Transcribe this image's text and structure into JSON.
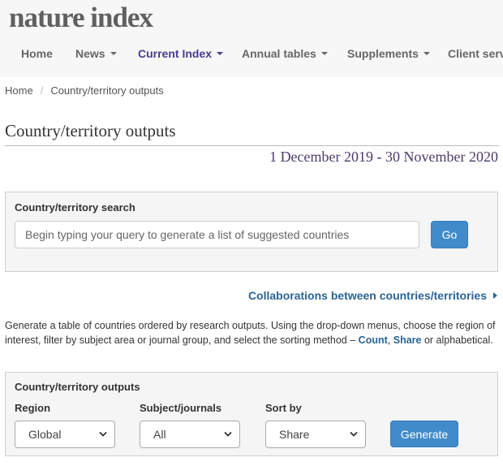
{
  "header": {
    "logo": "nature index",
    "nav": [
      {
        "label": "Home"
      },
      {
        "label": "News"
      },
      {
        "label": "Current Index"
      },
      {
        "label": "Annual tables"
      },
      {
        "label": "Supplements"
      },
      {
        "label": "Client serv"
      }
    ]
  },
  "breadcrumb": {
    "home": "Home",
    "separator": "/",
    "current": "Country/territory outputs"
  },
  "page": {
    "title": "Country/territory outputs",
    "date_start": "1 December 2019",
    "date_dash": "-",
    "date_end": "30 November 2020"
  },
  "search_panel": {
    "label": "Country/territory search",
    "placeholder": "Begin typing your query to generate a list of suggested countries",
    "button": "Go"
  },
  "collab_link": "Collaborations between countries/territories",
  "description": {
    "text_before": "Generate a table of countries ordered by research outputs. Using the drop-down menus, choose the region of interest, filter by subject area or journal group, and select the sorting method – ",
    "link_count": "Count",
    "comma": ", ",
    "link_share": "Share",
    "text_after": " or alphabetical."
  },
  "outputs_panel": {
    "title": "Country/territory outputs",
    "region_label": "Region",
    "region_value": "Global",
    "subject_label": "Subject/journals",
    "subject_value": "All",
    "sort_label": "Sort by",
    "sort_value": "Share",
    "button": "Generate"
  },
  "colors": {
    "header_bg": "#f7f7f7",
    "active_nav": "#4b3b8c",
    "link": "#2a6496",
    "button": "#428bca"
  }
}
